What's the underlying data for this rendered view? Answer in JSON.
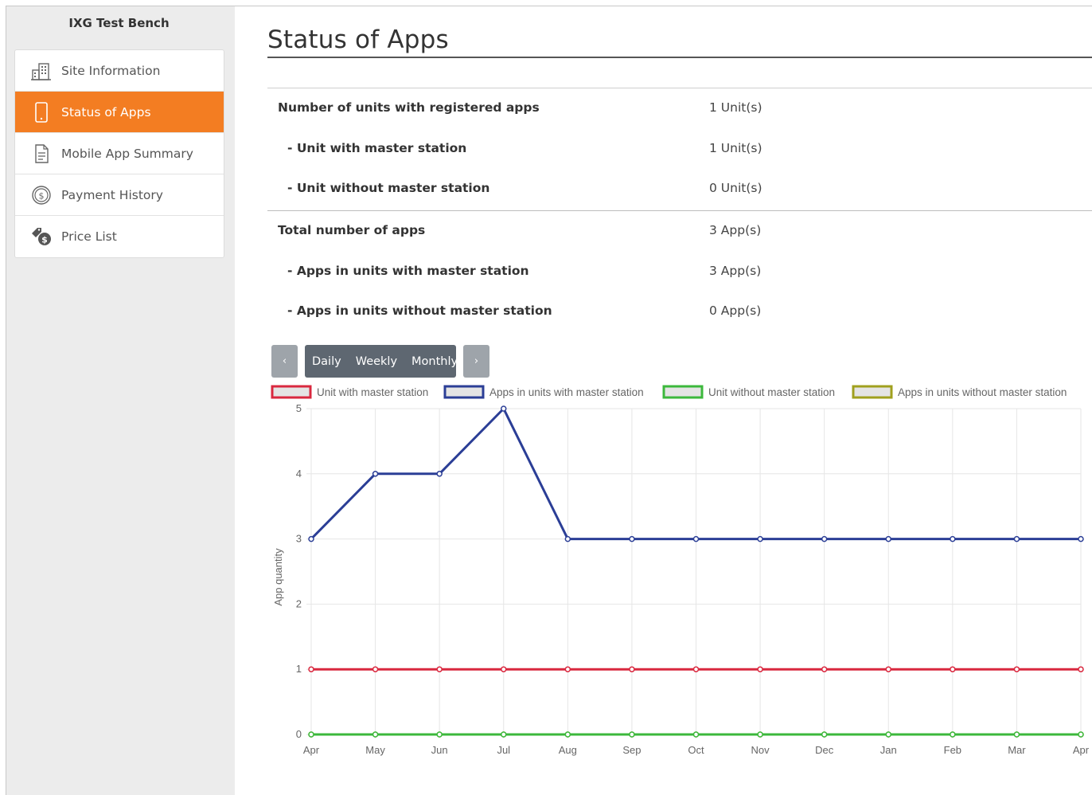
{
  "sidebar": {
    "site_name": "IXG Test Bench",
    "items": [
      {
        "label": "Site Information",
        "icon": "building-icon",
        "active": false
      },
      {
        "label": "Status of Apps",
        "icon": "smartphone-icon",
        "active": true
      },
      {
        "label": "Mobile App Summary",
        "icon": "document-icon",
        "active": false
      },
      {
        "label": "Payment History",
        "icon": "dollar-circle-icon",
        "active": false
      },
      {
        "label": "Price List",
        "icon": "price-tag-icon",
        "active": false
      }
    ]
  },
  "main": {
    "title": "Status of Apps",
    "stats": [
      {
        "label": "Number of units with registered apps",
        "value": "1 Unit(s)"
      },
      {
        "label": "- Unit with master station",
        "value": "1 Unit(s)"
      },
      {
        "label": "- Unit without master station",
        "value": "0 Unit(s)"
      },
      {
        "label": "Total number of apps",
        "value": "3 App(s)"
      },
      {
        "label": "- Apps in units with master station",
        "value": "3 App(s)"
      },
      {
        "label": "- Apps in units without master station",
        "value": "0 App(s)"
      }
    ],
    "period": {
      "prev": "‹",
      "next": "›",
      "options": [
        "Daily",
        "Weekly",
        "Monthly"
      ]
    }
  },
  "colors": {
    "accent": "#f37d22",
    "sidebar_bg": "#ececec",
    "period_group_bg": "#5e6771",
    "nav_button_bg": "#9ea4aa"
  },
  "chart_data": {
    "type": "line",
    "ylabel": "App quantity",
    "ylim": [
      0,
      5
    ],
    "yticks": [
      0,
      1,
      2,
      3,
      4,
      5
    ],
    "categories": [
      "Apr",
      "May",
      "Jun",
      "Jul",
      "Aug",
      "Sep",
      "Oct",
      "Nov",
      "Dec",
      "Jan",
      "Feb",
      "Mar",
      "Apr"
    ],
    "grid": true,
    "legend_position": "top",
    "series": [
      {
        "name": "Unit with master station",
        "color": "#d9283f",
        "values": [
          1,
          1,
          1,
          1,
          1,
          1,
          1,
          1,
          1,
          1,
          1,
          1,
          1
        ]
      },
      {
        "name": "Apps in units with master station",
        "color": "#2b3e96",
        "values": [
          3,
          4,
          4,
          5,
          3,
          3,
          3,
          3,
          3,
          3,
          3,
          3,
          3
        ]
      },
      {
        "name": "Unit without master station",
        "color": "#3cb83c",
        "values": [
          0,
          0,
          0,
          0,
          0,
          0,
          0,
          0,
          0,
          0,
          0,
          0,
          0
        ]
      },
      {
        "name": "Apps in units without master station",
        "color": "#a0a01e",
        "values": [
          0,
          0,
          0,
          0,
          0,
          0,
          0,
          0,
          0,
          0,
          0,
          0,
          0
        ]
      }
    ]
  }
}
